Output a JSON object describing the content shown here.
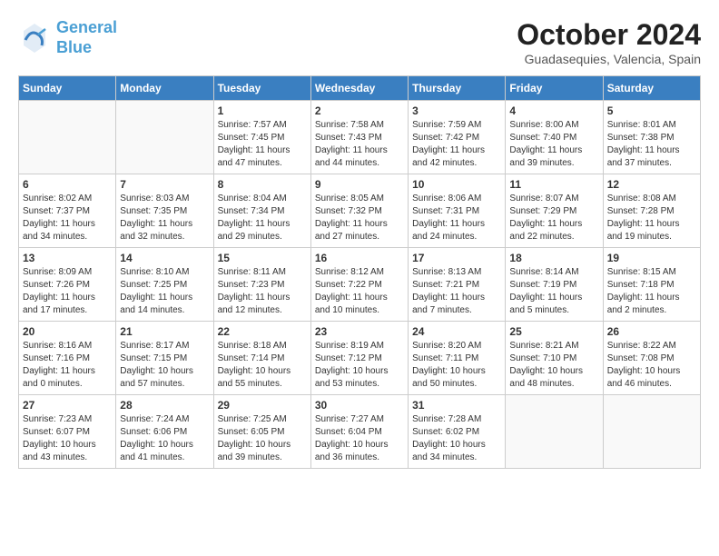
{
  "header": {
    "logo_line1": "General",
    "logo_line2": "Blue",
    "month": "October 2024",
    "location": "Guadasequies, Valencia, Spain"
  },
  "weekdays": [
    "Sunday",
    "Monday",
    "Tuesday",
    "Wednesday",
    "Thursday",
    "Friday",
    "Saturday"
  ],
  "weeks": [
    [
      {
        "day": null,
        "info": ""
      },
      {
        "day": null,
        "info": ""
      },
      {
        "day": "1",
        "info": "Sunrise: 7:57 AM\nSunset: 7:45 PM\nDaylight: 11 hours and 47 minutes."
      },
      {
        "day": "2",
        "info": "Sunrise: 7:58 AM\nSunset: 7:43 PM\nDaylight: 11 hours and 44 minutes."
      },
      {
        "day": "3",
        "info": "Sunrise: 7:59 AM\nSunset: 7:42 PM\nDaylight: 11 hours and 42 minutes."
      },
      {
        "day": "4",
        "info": "Sunrise: 8:00 AM\nSunset: 7:40 PM\nDaylight: 11 hours and 39 minutes."
      },
      {
        "day": "5",
        "info": "Sunrise: 8:01 AM\nSunset: 7:38 PM\nDaylight: 11 hours and 37 minutes."
      }
    ],
    [
      {
        "day": "6",
        "info": "Sunrise: 8:02 AM\nSunset: 7:37 PM\nDaylight: 11 hours and 34 minutes."
      },
      {
        "day": "7",
        "info": "Sunrise: 8:03 AM\nSunset: 7:35 PM\nDaylight: 11 hours and 32 minutes."
      },
      {
        "day": "8",
        "info": "Sunrise: 8:04 AM\nSunset: 7:34 PM\nDaylight: 11 hours and 29 minutes."
      },
      {
        "day": "9",
        "info": "Sunrise: 8:05 AM\nSunset: 7:32 PM\nDaylight: 11 hours and 27 minutes."
      },
      {
        "day": "10",
        "info": "Sunrise: 8:06 AM\nSunset: 7:31 PM\nDaylight: 11 hours and 24 minutes."
      },
      {
        "day": "11",
        "info": "Sunrise: 8:07 AM\nSunset: 7:29 PM\nDaylight: 11 hours and 22 minutes."
      },
      {
        "day": "12",
        "info": "Sunrise: 8:08 AM\nSunset: 7:28 PM\nDaylight: 11 hours and 19 minutes."
      }
    ],
    [
      {
        "day": "13",
        "info": "Sunrise: 8:09 AM\nSunset: 7:26 PM\nDaylight: 11 hours and 17 minutes."
      },
      {
        "day": "14",
        "info": "Sunrise: 8:10 AM\nSunset: 7:25 PM\nDaylight: 11 hours and 14 minutes."
      },
      {
        "day": "15",
        "info": "Sunrise: 8:11 AM\nSunset: 7:23 PM\nDaylight: 11 hours and 12 minutes."
      },
      {
        "day": "16",
        "info": "Sunrise: 8:12 AM\nSunset: 7:22 PM\nDaylight: 11 hours and 10 minutes."
      },
      {
        "day": "17",
        "info": "Sunrise: 8:13 AM\nSunset: 7:21 PM\nDaylight: 11 hours and 7 minutes."
      },
      {
        "day": "18",
        "info": "Sunrise: 8:14 AM\nSunset: 7:19 PM\nDaylight: 11 hours and 5 minutes."
      },
      {
        "day": "19",
        "info": "Sunrise: 8:15 AM\nSunset: 7:18 PM\nDaylight: 11 hours and 2 minutes."
      }
    ],
    [
      {
        "day": "20",
        "info": "Sunrise: 8:16 AM\nSunset: 7:16 PM\nDaylight: 11 hours and 0 minutes."
      },
      {
        "day": "21",
        "info": "Sunrise: 8:17 AM\nSunset: 7:15 PM\nDaylight: 10 hours and 57 minutes."
      },
      {
        "day": "22",
        "info": "Sunrise: 8:18 AM\nSunset: 7:14 PM\nDaylight: 10 hours and 55 minutes."
      },
      {
        "day": "23",
        "info": "Sunrise: 8:19 AM\nSunset: 7:12 PM\nDaylight: 10 hours and 53 minutes."
      },
      {
        "day": "24",
        "info": "Sunrise: 8:20 AM\nSunset: 7:11 PM\nDaylight: 10 hours and 50 minutes."
      },
      {
        "day": "25",
        "info": "Sunrise: 8:21 AM\nSunset: 7:10 PM\nDaylight: 10 hours and 48 minutes."
      },
      {
        "day": "26",
        "info": "Sunrise: 8:22 AM\nSunset: 7:08 PM\nDaylight: 10 hours and 46 minutes."
      }
    ],
    [
      {
        "day": "27",
        "info": "Sunrise: 7:23 AM\nSunset: 6:07 PM\nDaylight: 10 hours and 43 minutes."
      },
      {
        "day": "28",
        "info": "Sunrise: 7:24 AM\nSunset: 6:06 PM\nDaylight: 10 hours and 41 minutes."
      },
      {
        "day": "29",
        "info": "Sunrise: 7:25 AM\nSunset: 6:05 PM\nDaylight: 10 hours and 39 minutes."
      },
      {
        "day": "30",
        "info": "Sunrise: 7:27 AM\nSunset: 6:04 PM\nDaylight: 10 hours and 36 minutes."
      },
      {
        "day": "31",
        "info": "Sunrise: 7:28 AM\nSunset: 6:02 PM\nDaylight: 10 hours and 34 minutes."
      },
      {
        "day": null,
        "info": ""
      },
      {
        "day": null,
        "info": ""
      }
    ]
  ]
}
